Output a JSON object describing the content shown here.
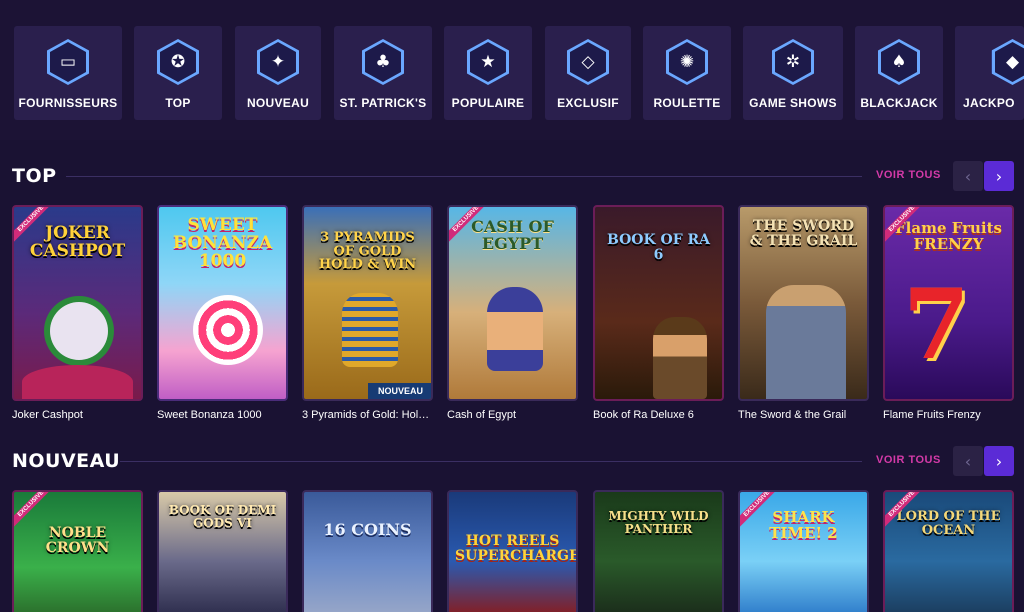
{
  "categories": [
    {
      "label": "FOURNISSEURS",
      "icon": "folder-icon",
      "glyph": "▭"
    },
    {
      "label": "TOP",
      "icon": "award-icon",
      "glyph": "✪"
    },
    {
      "label": "NOUVEAU",
      "icon": "sparkle-icon",
      "glyph": "✦"
    },
    {
      "label": "ST. PATRICK'S",
      "icon": "leprechaun-hat-icon",
      "glyph": "♣"
    },
    {
      "label": "POPULAIRE",
      "icon": "star-icon",
      "glyph": "★"
    },
    {
      "label": "EXCLUSIF",
      "icon": "diamond-icon",
      "glyph": "◇"
    },
    {
      "label": "ROULETTE",
      "icon": "roulette-icon",
      "glyph": "✺"
    },
    {
      "label": "GAME SHOWS",
      "icon": "wheel-icon",
      "glyph": "✲"
    },
    {
      "label": "BLACKJACK",
      "icon": "spade-icon",
      "glyph": "♠"
    },
    {
      "label": "JACKPO",
      "icon": "jackpot-icon",
      "glyph": "◆"
    }
  ],
  "sections": {
    "top": {
      "title": "TOP",
      "see_all": "VOIR TOUS",
      "prev": "‹",
      "next": "›"
    },
    "nouveau": {
      "title": "NOUVEAU",
      "see_all": "VOIR TOUS",
      "prev": "‹",
      "next": "›"
    }
  },
  "top_games": [
    {
      "name": "Joker Cashpot",
      "logo": "JOKER CASHPOT",
      "exclusive": "EXCLUSIVE"
    },
    {
      "name": "Sweet Bonanza 1000",
      "logo": "SWEET BONANZA 1000"
    },
    {
      "name": "3 Pyramids of Gold: Hol…",
      "logo": "3 PYRAMIDS OF GOLD HOLD & WIN",
      "badge": "NOUVEAU"
    },
    {
      "name": "Cash of Egypt",
      "logo": "CASH OF EGYPT",
      "exclusive": "EXCLUSIVE"
    },
    {
      "name": "Book of Ra Deluxe 6",
      "logo": "BOOK OF RA 6"
    },
    {
      "name": "The Sword & the Grail",
      "logo": "THE SWORD & THE GRAIL"
    },
    {
      "name": "Flame Fruits Frenzy",
      "logo": "Flame Fruits FRENZY",
      "exclusive": "EXCLUSIVE"
    }
  ],
  "new_games": [
    {
      "logo": "NOBLE CROWN",
      "exclusive": "EXCLUSIVE"
    },
    {
      "logo": "BOOK OF DEMI GODS VI"
    },
    {
      "logo": "16 COINS"
    },
    {
      "logo": "HOT REELS SUPERCHARGED"
    },
    {
      "logo": "MIGHTY WILD PANTHER"
    },
    {
      "logo": "SHARK TIME! 2",
      "exclusive": "EXCLUSIVE"
    },
    {
      "logo": "LORD OF THE OCEAN",
      "exclusive": "EXCLUSIVE"
    }
  ]
}
